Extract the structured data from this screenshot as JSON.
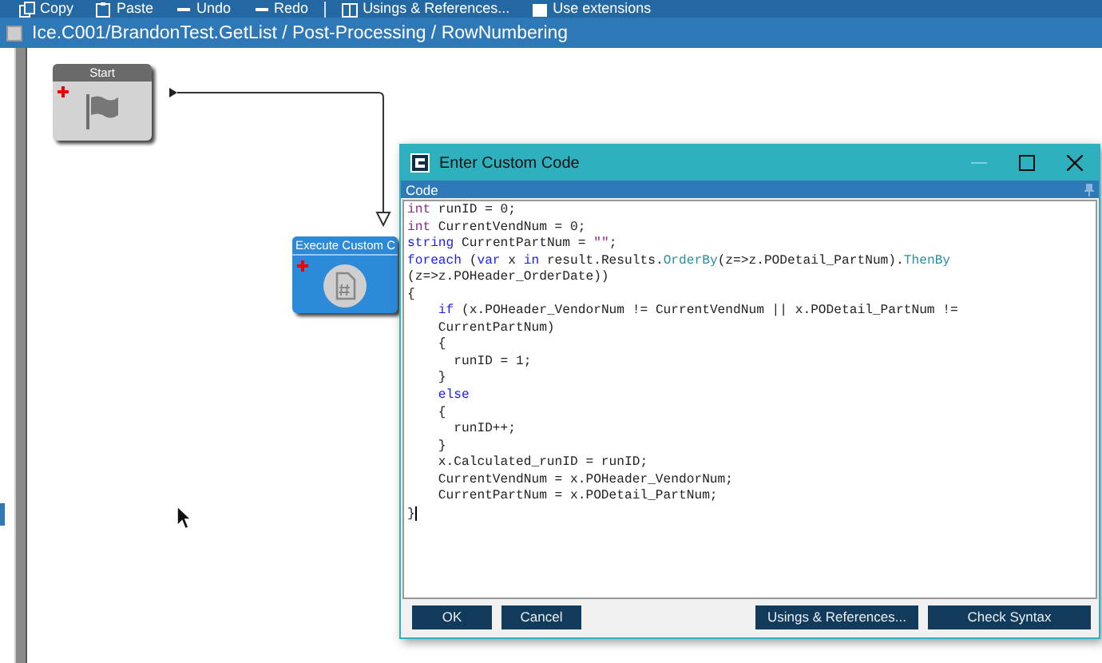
{
  "toolbar": [
    {
      "label": "Copy"
    },
    {
      "label": "Paste"
    },
    {
      "label": "Undo"
    },
    {
      "label": "Redo"
    },
    {
      "label": "Usings & References..."
    },
    {
      "label": "Use extensions"
    }
  ],
  "breadcrumb": "Ice.C001/BrandonTest.GetList / Post-Processing / RowNumbering",
  "nodes": [
    {
      "kind": "start",
      "title": "Start"
    },
    {
      "kind": "code",
      "title": "Execute Custom C"
    }
  ],
  "dialog": {
    "title": "Enter Custom Code",
    "panel_title": "Code",
    "code_lines": [
      [
        {
          "t": "int",
          "kind": "type"
        },
        {
          "t": " runID = 0;",
          "kind": "plain"
        }
      ],
      [
        {
          "t": "int",
          "kind": "type"
        },
        {
          "t": " CurrentVendNum = 0;",
          "kind": "plain"
        }
      ],
      [
        {
          "t": "string",
          "kind": "keyword"
        },
        {
          "t": " CurrentPartNum = ",
          "kind": "plain"
        },
        {
          "t": "\"\"",
          "kind": "string"
        },
        {
          "t": ";",
          "kind": "plain"
        }
      ],
      [
        {
          "t": "foreach",
          "kind": "keyword"
        },
        {
          "t": " (",
          "kind": "plain"
        },
        {
          "t": "var",
          "kind": "keyword"
        },
        {
          "t": " x ",
          "kind": "plain"
        },
        {
          "t": "in",
          "kind": "keyword"
        },
        {
          "t": " result.Results.",
          "kind": "plain"
        },
        {
          "t": "OrderBy",
          "kind": "method"
        },
        {
          "t": "(z=>z.PODetail_PartNum).",
          "kind": "plain"
        },
        {
          "t": "ThenBy",
          "kind": "method"
        }
      ],
      [
        {
          "t": "(z=>z.POHeader_OrderDate))",
          "kind": "plain"
        }
      ],
      [
        {
          "t": "{",
          "kind": "plain"
        }
      ],
      [
        {
          "t": "    if",
          "kind": "keyword"
        },
        {
          "t": " (x.POHeader_VendorNum != CurrentVendNum || x.PODetail_PartNum !=",
          "kind": "plain"
        }
      ],
      [
        {
          "t": "    CurrentPartNum)",
          "kind": "plain"
        }
      ],
      [
        {
          "t": "    {",
          "kind": "plain"
        }
      ],
      [
        {
          "t": "      runID = 1;",
          "kind": "plain"
        }
      ],
      [
        {
          "t": "    }",
          "kind": "plain"
        }
      ],
      [
        {
          "t": "    else",
          "kind": "keyword"
        }
      ],
      [
        {
          "t": "    {",
          "kind": "plain"
        }
      ],
      [
        {
          "t": "      runID++;",
          "kind": "plain"
        }
      ],
      [
        {
          "t": "    }",
          "kind": "plain"
        }
      ],
      [
        {
          "t": "    x.Calculated_runID = runID;",
          "kind": "plain"
        }
      ],
      [
        {
          "t": "    CurrentVendNum = x.POHeader_VendorNum;",
          "kind": "plain"
        }
      ],
      [
        {
          "t": "    CurrentPartNum = x.PODetail_PartNum;",
          "kind": "plain"
        }
      ],
      [
        {
          "t": "}",
          "kind": "plain"
        }
      ]
    ],
    "buttons_left": [
      "OK",
      "Cancel"
    ],
    "buttons_right": [
      "Usings & References...",
      "Check Syntax"
    ]
  }
}
